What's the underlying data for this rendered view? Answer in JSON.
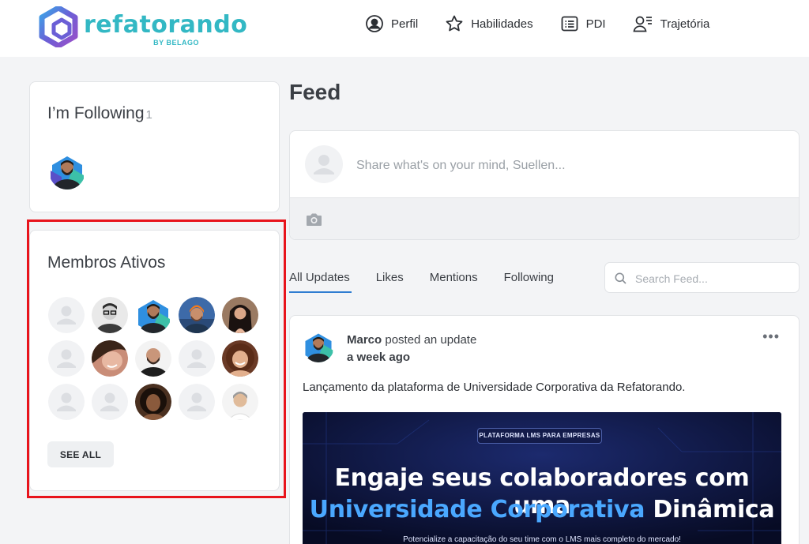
{
  "brand": {
    "name": "refatorando",
    "sub": "BY BELAGO",
    "color": "#33b8c4"
  },
  "nav": [
    {
      "label": "Perfil",
      "icon": "user-circle-icon"
    },
    {
      "label": "Habilidades",
      "icon": "star-icon"
    },
    {
      "label": "PDI",
      "icon": "list-icon"
    },
    {
      "label": "Trajetória",
      "icon": "user-list-icon"
    }
  ],
  "following": {
    "title": "I’m Following",
    "count": "1"
  },
  "members": {
    "title": "Membros Ativos",
    "see_all": "SEE ALL",
    "avatars": [
      "placeholder",
      "glasses-man",
      "bearded-man",
      "orange-beanie-man",
      "dark-hair-woman",
      "placeholder",
      "smiling-woman",
      "bald-man",
      "placeholder",
      "curly-woman",
      "placeholder",
      "placeholder",
      "dark-woman",
      "placeholder",
      "asian-man"
    ]
  },
  "feed": {
    "title": "Feed",
    "composer_placeholder": "Share what's on your mind, Suellen...",
    "tabs": [
      "All Updates",
      "Likes",
      "Mentions",
      "Following"
    ],
    "active_tab": "All Updates",
    "search_placeholder": "Search Feed..."
  },
  "post": {
    "author": "Marco",
    "action": "posted an update",
    "time": "a week ago",
    "more": "•••",
    "text": "Lançamento da plataforma de Universidade Corporativa da Refatorando.",
    "banner": {
      "tag": "PLATAFORMA LMS PARA EMPRESAS",
      "line1": "Engaje seus colaboradores com uma",
      "line2_blue": "Universidade Corporativa",
      "line2_white": "Dinâmica",
      "subtitle": "Potencialize a capacitação do seu time com o LMS mais completo do mercado!"
    }
  },
  "colors": {
    "accent": "#2f7dd1",
    "highlight": "#e8141c",
    "banner_bg": "#0a1030"
  }
}
